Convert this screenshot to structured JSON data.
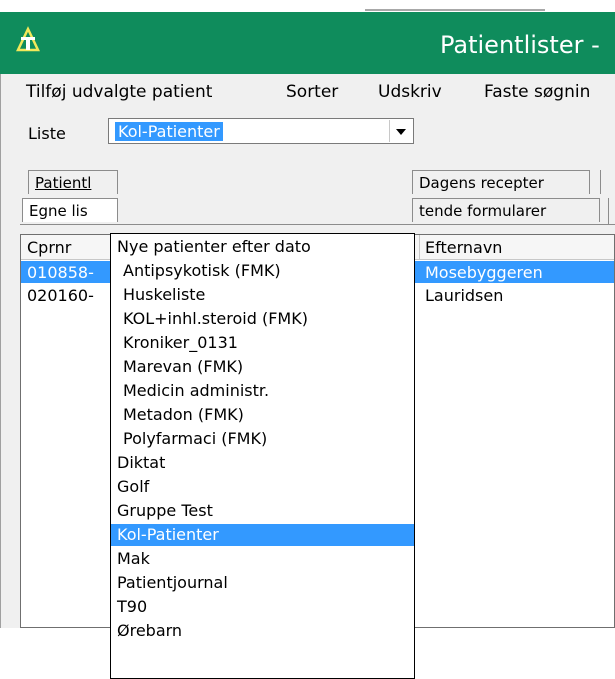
{
  "window": {
    "title": "Patientlister -"
  },
  "menu": {
    "items": [
      {
        "label": "Tilføj udvalgte patient"
      },
      {
        "label": "Sorter"
      },
      {
        "label": "Udskriv"
      },
      {
        "label": "Faste søgnin"
      }
    ]
  },
  "liste": {
    "label": "Liste",
    "selected": "Kol-Patienter"
  },
  "tabs": {
    "row1": [
      {
        "label": "Patientl"
      },
      {
        "label": "Dagens recepter"
      }
    ],
    "row2": [
      {
        "label": "Egne lis"
      },
      {
        "label": "tende formularer"
      }
    ]
  },
  "grid": {
    "headers": {
      "cprnr": "Cprnr",
      "efternavn": "Efternavn"
    },
    "rows": [
      {
        "cprnr": "010858-",
        "efternavn": "Mosebyggeren",
        "selected": true
      },
      {
        "cprnr": "020160-",
        "efternavn": "Lauridsen",
        "selected": false
      }
    ]
  },
  "dropdown": {
    "items": [
      {
        "label": "Nye patienter efter dato",
        "selected": false
      },
      {
        "label": "Antipsykotisk (FMK)",
        "selected": false
      },
      {
        "label": "Huskeliste",
        "selected": false
      },
      {
        "label": "KOL+inhl.steroid (FMK)",
        "selected": false
      },
      {
        "label": "Kroniker_0131",
        "selected": false
      },
      {
        "label": "Marevan (FMK)",
        "selected": false
      },
      {
        "label": "Medicin administr.",
        "selected": false
      },
      {
        "label": "Metadon (FMK)",
        "selected": false
      },
      {
        "label": "Polyfarmaci (FMK)",
        "selected": false
      },
      {
        "label": "Diktat",
        "selected": false
      },
      {
        "label": "Golf",
        "selected": false
      },
      {
        "label": "Gruppe Test",
        "selected": false
      },
      {
        "label": "Kol-Patienter",
        "selected": true
      },
      {
        "label": "Mak",
        "selected": false
      },
      {
        "label": "Patientjournal",
        "selected": false
      },
      {
        "label": "T90",
        "selected": false
      },
      {
        "label": "Ørebarn",
        "selected": false
      }
    ]
  },
  "colors": {
    "titlebar": "#0f8c5c",
    "selection": "#3399ff"
  },
  "icons": {
    "app": "app-logo-icon",
    "combo": "chevron-down-icon"
  }
}
